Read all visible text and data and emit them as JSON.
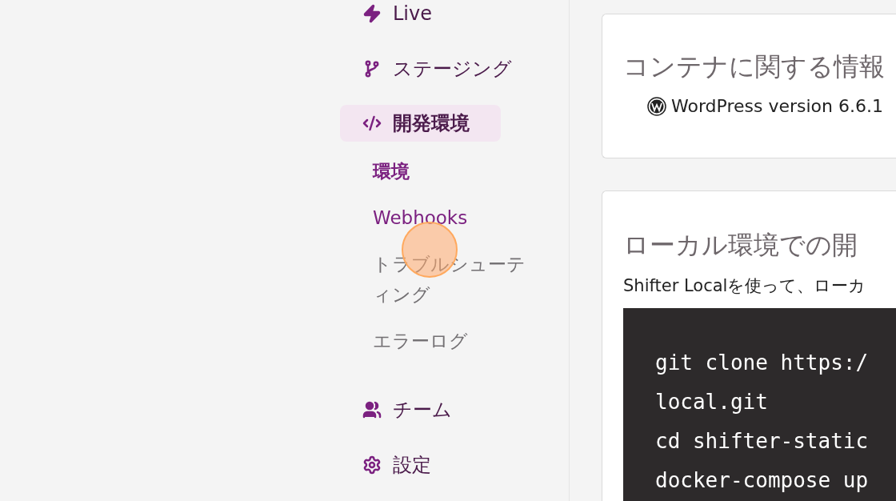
{
  "nav": [
    {
      "label": "Live",
      "selected": false
    },
    {
      "label": "ステージング",
      "selected": false
    },
    {
      "label": "開発環境",
      "selected": true,
      "children": [
        {
          "label": "環境",
          "selected": true,
          "hovered": false
        },
        {
          "label": "Webhooks",
          "selected": false,
          "hovered": true
        },
        {
          "label": "トラブルシューティング",
          "selected": false,
          "hovered": false
        },
        {
          "label": "エラーログ",
          "selected": false,
          "hovered": false
        }
      ]
    },
    {
      "label": "チーム",
      "selected": false
    },
    {
      "label": "設定",
      "selected": false
    }
  ],
  "container_card": {
    "title": "コンテナに関する情報",
    "version": "WordPress version 6.6.1"
  },
  "local_card": {
    "title": "ローカル環境での開",
    "text": "Shifter Localを使って、ローカ",
    "code": [
      "git clone https:/",
      "local.git",
      "cd shifter-static",
      "docker-compose up"
    ]
  }
}
